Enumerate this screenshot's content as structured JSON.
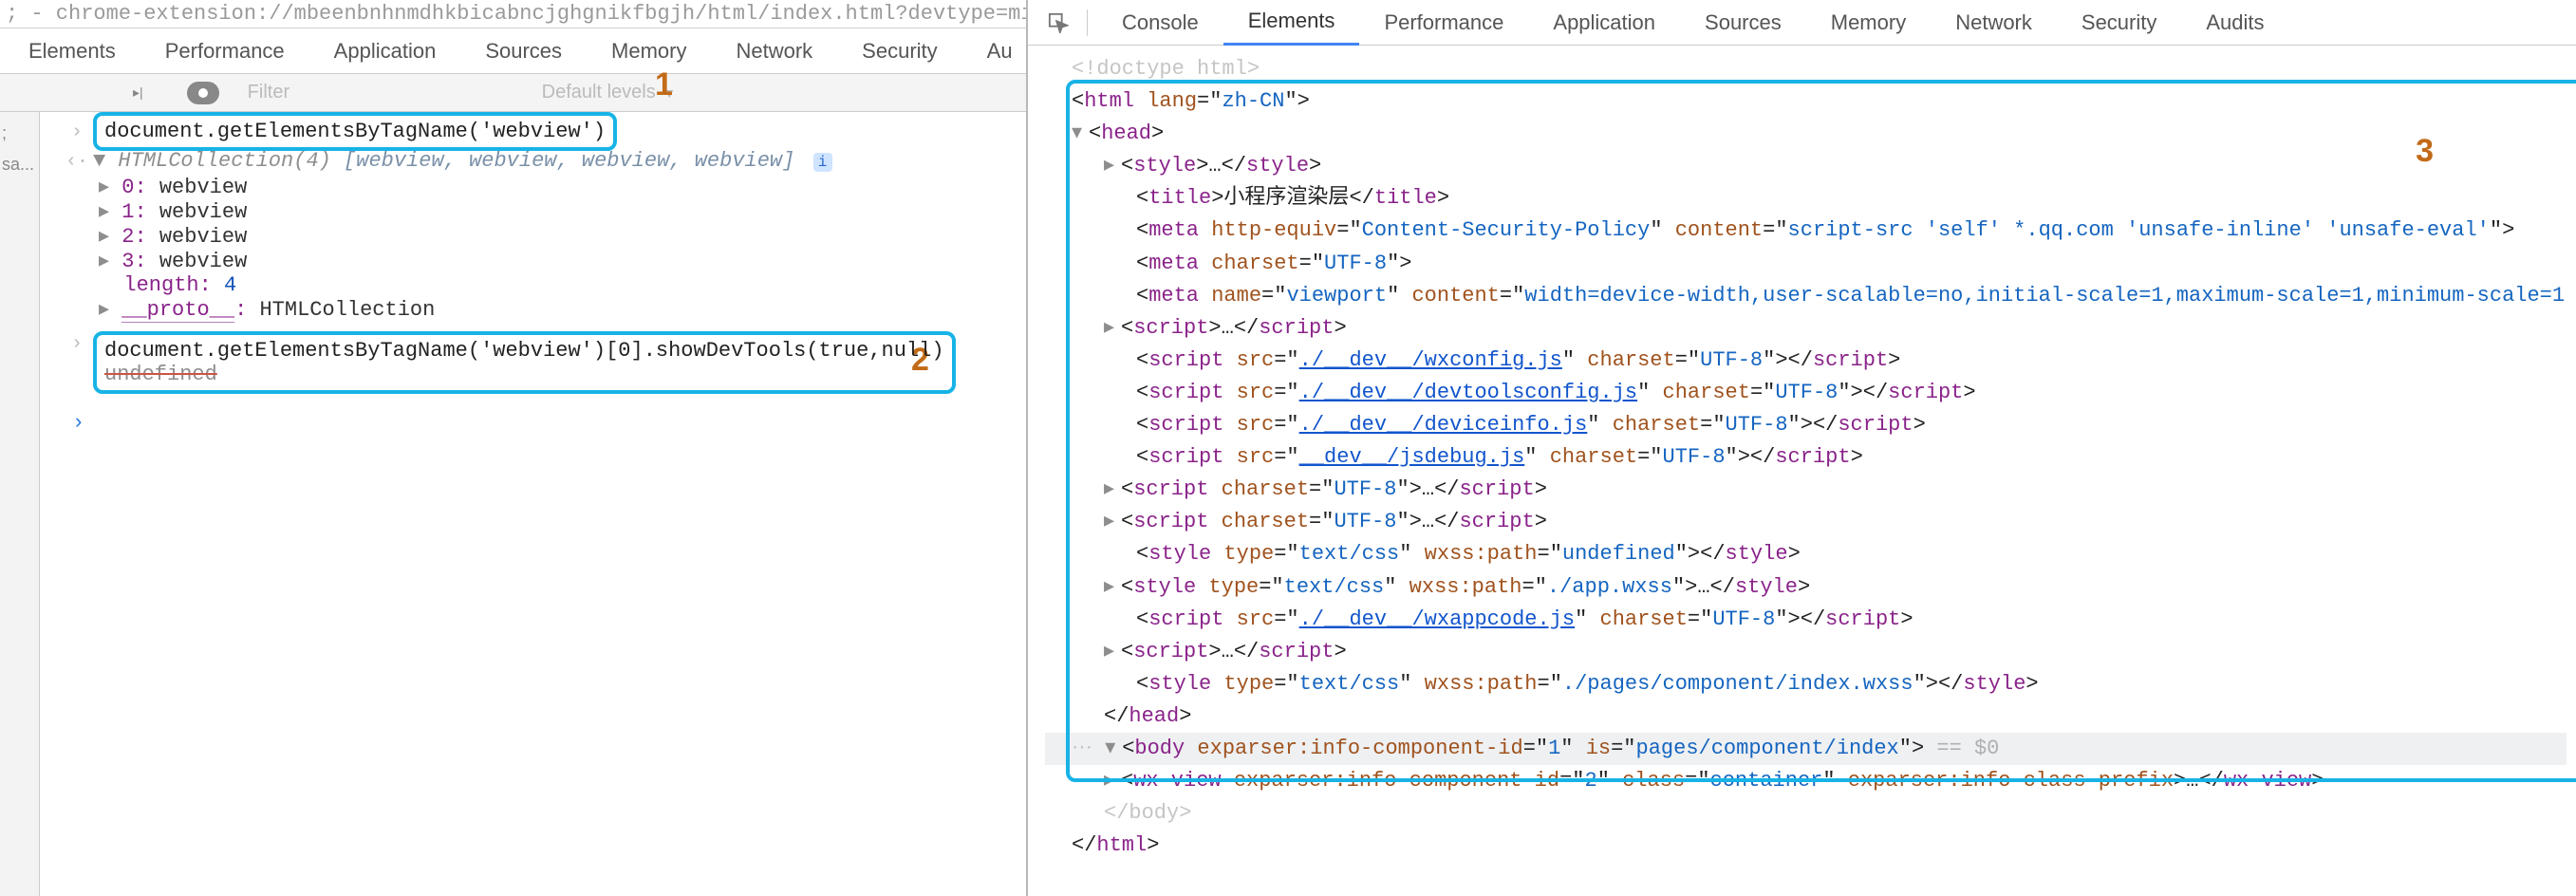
{
  "address_bar": "; - chrome-extension://mbeenbnhnmdhkbicabncjghgnikfbgjh/html/index.html?devtype=mir",
  "left_tabs": [
    "Elements",
    "Performance",
    "Application",
    "Sources",
    "Memory",
    "Network",
    "Security",
    "Au"
  ],
  "right_tabs": [
    "Console",
    "Elements",
    "Performance",
    "Application",
    "Sources",
    "Memory",
    "Network",
    "Security",
    "Audits"
  ],
  "right_active_tab": "Elements",
  "toolbar": {
    "filter_placeholder": "Filter",
    "levels_label": "Default levels"
  },
  "left_sidebar": {
    "stub1": ";",
    "stub2": "sa..."
  },
  "annotations": {
    "one": "1",
    "two": "2",
    "three": "3"
  },
  "console": {
    "cmd1": "document.getElementsByTagName('webview')",
    "resultHeader": {
      "prefix": "HTMLCollection(4)",
      "list": "[webview, webview, webview, webview]"
    },
    "rows": [
      {
        "idx": "0",
        "val": "webview"
      },
      {
        "idx": "1",
        "val": "webview"
      },
      {
        "idx": "2",
        "val": "webview"
      },
      {
        "idx": "3",
        "val": "webview"
      }
    ],
    "length_label": "length",
    "length_val": "4",
    "proto_label": "__proto__",
    "proto_val": "HTMLCollection",
    "cmd2": "document.getElementsByTagName('webview')[0].showDevTools(true,null)",
    "undef": "undefined"
  },
  "elements": {
    "doctype": "<!doctype html>",
    "htmlOpen": {
      "tag": "html",
      "attr": "lang",
      "val": "zh-CN"
    },
    "headOpen": "head",
    "styleEllipsis": {
      "tag": "style",
      "ell": "…"
    },
    "title": {
      "tag": "title",
      "text": "小程序渲染层"
    },
    "metaCSP": {
      "he": "http-equiv",
      "heVal": "Content-Security-Policy",
      "c": "content",
      "cVal": "script-src 'self' *.qq.com 'unsafe-inline' 'unsafe-eval'"
    },
    "metaCharset": {
      "attr": "charset",
      "val": "UTF-8"
    },
    "metaViewport": {
      "n": "name",
      "nVal": "viewport",
      "c": "content",
      "cVal": "width=device-width,user-scalable=no,initial-scale=1,maximum-scale=1,minimum-scale=1"
    },
    "scriptEllipsis": {
      "tag": "script",
      "ell": "…"
    },
    "scripts": [
      {
        "src": "./__dev__/wxconfig.js",
        "charset": "UTF-8"
      },
      {
        "src": "./__dev__/devtoolsconfig.js",
        "charset": "UTF-8"
      },
      {
        "src": "./__dev__/deviceinfo.js",
        "charset": "UTF-8"
      },
      {
        "src": "__dev__/jsdebug.js",
        "charset": "UTF-8"
      }
    ],
    "scriptCharsetOnly": {
      "charset": "UTF-8",
      "ell": "…"
    },
    "styleUndef": {
      "type": "text/css",
      "wx": "wxss:path",
      "wxVal": "undefined"
    },
    "styleApp": {
      "type": "text/css",
      "wx": "wxss:path",
      "wxVal": "./app.wxss",
      "ell": "…"
    },
    "scriptAppcode": {
      "src": "./__dev__/wxappcode.js",
      "charset": "UTF-8"
    },
    "stylePage": {
      "type": "text/css",
      "wx": "wxss:path",
      "wxVal": "./pages/component/index.wxss"
    },
    "headClose": "head",
    "body": {
      "a1": "exparser:info-component-id",
      "v1": "1",
      "a2": "is",
      "v2": "pages/component/index",
      "eq": " == $0"
    },
    "wxview": {
      "a1": "exparser:info-component-id",
      "v1": "2",
      "a2": "class",
      "v2": "container",
      "a3": "exparser:info-class-prefix",
      "ell": "…"
    },
    "bodyClose": "body",
    "htmlClose": "html"
  }
}
